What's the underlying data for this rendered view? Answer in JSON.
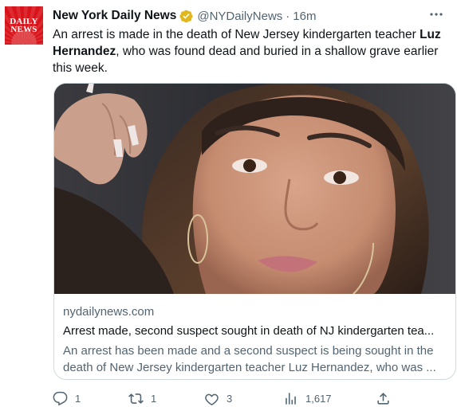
{
  "account": {
    "avatar_logo_text": "DAILY NEWS",
    "avatar_logo_line1": "DAILY",
    "avatar_logo_line2": "NEWS",
    "display_name": "New York Daily News",
    "handle": "@NYDailyNews",
    "separator": "·",
    "time": "16m",
    "verified_color": "#e2b719",
    "brand_color": "#d8141a"
  },
  "tweet": {
    "text_before": "An arrest is made in the death of New Jersey kindergarten teacher ",
    "text_bold": "Luz Hernandez",
    "text_after": ", who was found dead and buried in a shallow grave earlier this week."
  },
  "card": {
    "domain": "nydailynews.com",
    "title": "Arrest made, second suspect sought in death of NJ kindergarten tea...",
    "description": "An arrest has been made and a second suspect is being sought in the death of New Jersey kindergarten teacher Luz Hernandez, who was ..."
  },
  "actions": {
    "replies": "1",
    "retweets": "1",
    "likes": "3",
    "views": "1,617"
  },
  "icons": {
    "more": "more-dots-icon",
    "reply": "reply-icon",
    "retweet": "retweet-icon",
    "like": "heart-icon",
    "views": "views-icon",
    "share": "share-icon",
    "verified": "verified-badge-icon"
  }
}
